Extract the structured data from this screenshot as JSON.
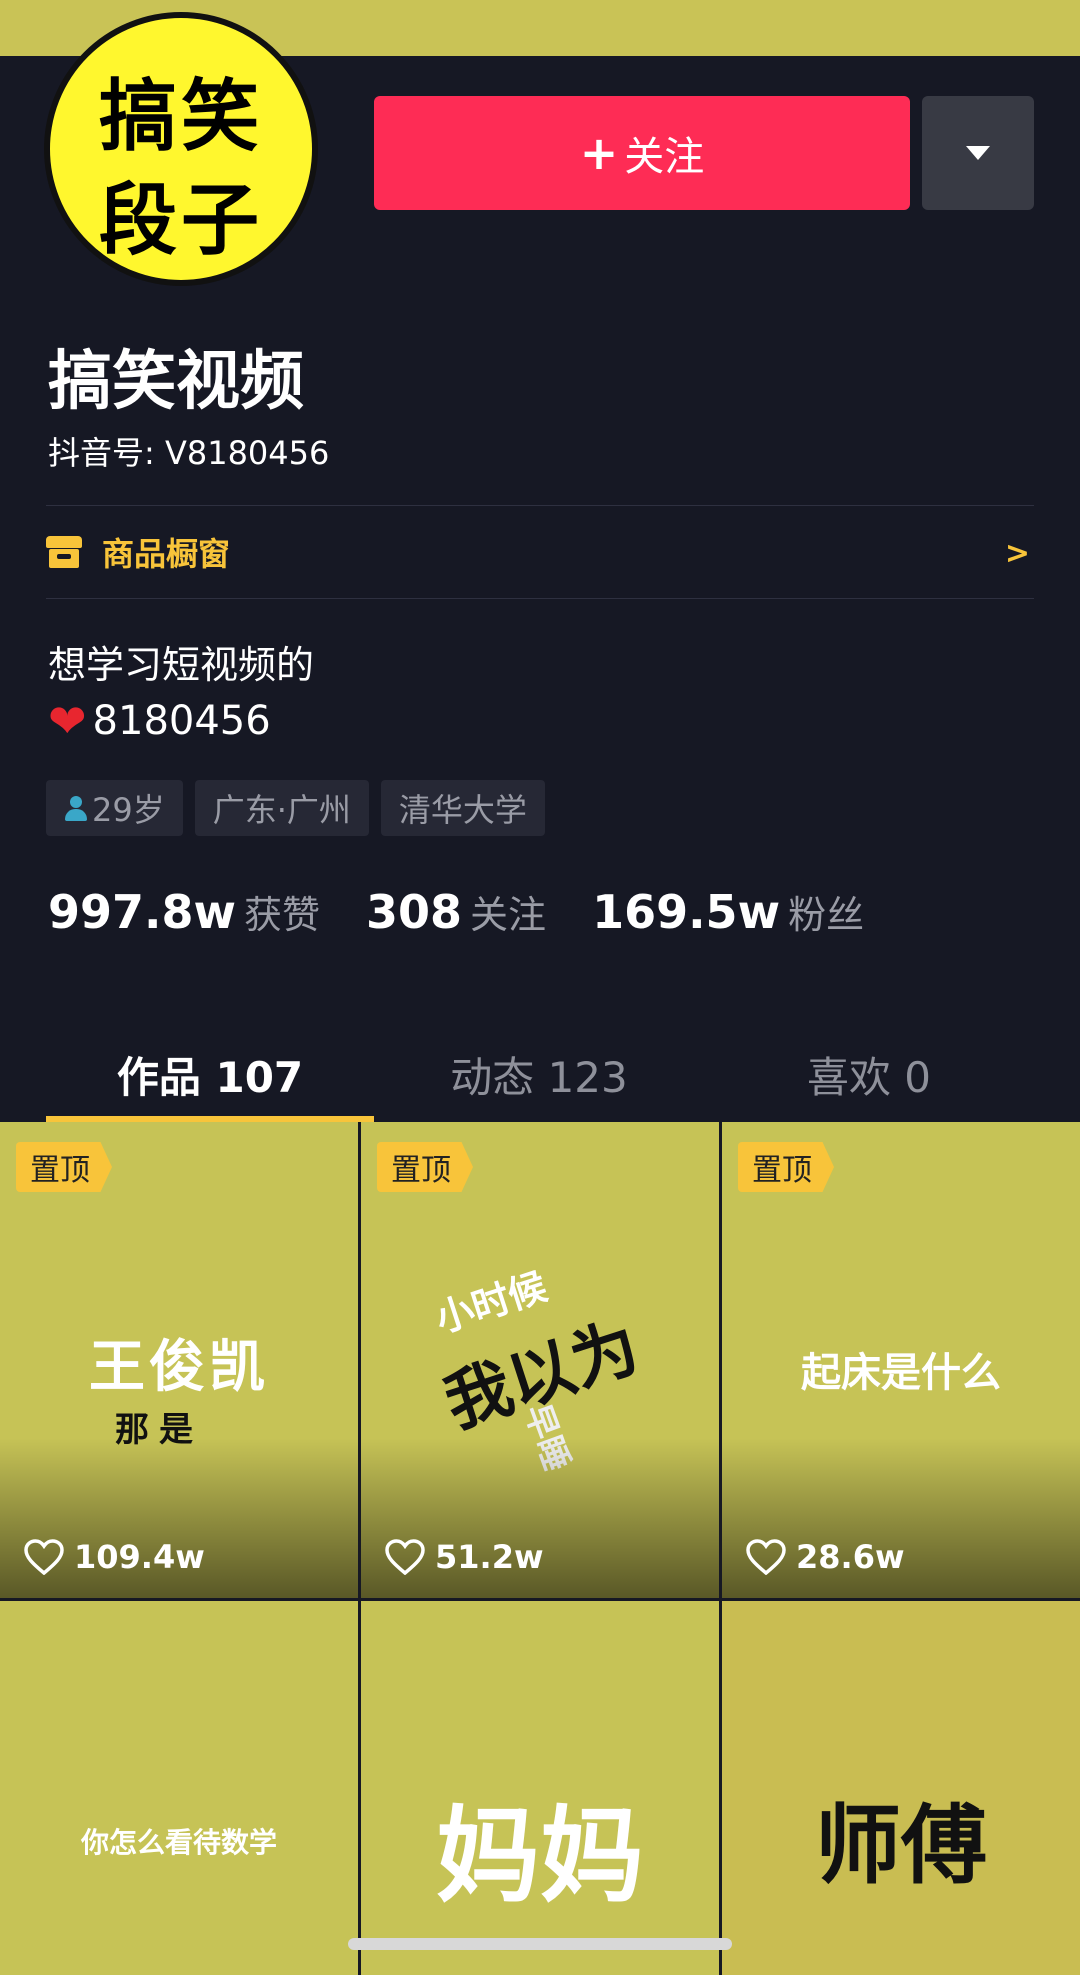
{
  "avatar": {
    "line1": "搞笑",
    "line2": "段子"
  },
  "actions": {
    "follow_label": "关注",
    "follow_plus": "+"
  },
  "profile": {
    "name": "搞笑视频",
    "douyin_id": "抖音号: V8180456",
    "shop_label": "商品橱窗",
    "bio_line1": "想学习短视频的",
    "bio_line2": "8180456",
    "tags": {
      "age": "29岁",
      "location": "广东·广州",
      "school": "清华大学"
    }
  },
  "stats": {
    "likes_num": "997.8w",
    "likes_label": "获赞",
    "following_num": "308",
    "following_label": "关注",
    "fans_num": "169.5w",
    "fans_label": "粉丝"
  },
  "tabs": {
    "works": "作品 107",
    "activity": "动态 123",
    "likes": "喜欢 0"
  },
  "videos": [
    {
      "pinned": "置顶",
      "likes": "109.4w",
      "text_main": "王俊凯",
      "text_sub": "那是"
    },
    {
      "pinned": "置顶",
      "likes": "51.2w",
      "text_top": "小时候",
      "text_main": "我以为",
      "text_sub": "早睡"
    },
    {
      "pinned": "置顶",
      "likes": "28.6w",
      "text_main": "起床是什么"
    },
    {
      "text_main": "你怎么看待数学"
    },
    {
      "text_main": "妈妈"
    },
    {
      "text_main": "师傅"
    }
  ],
  "colors": {
    "background": "#161824",
    "follow_red": "#fe2c55",
    "accent_yellow": "#f8c43a",
    "tile_green": "#c6c356"
  }
}
